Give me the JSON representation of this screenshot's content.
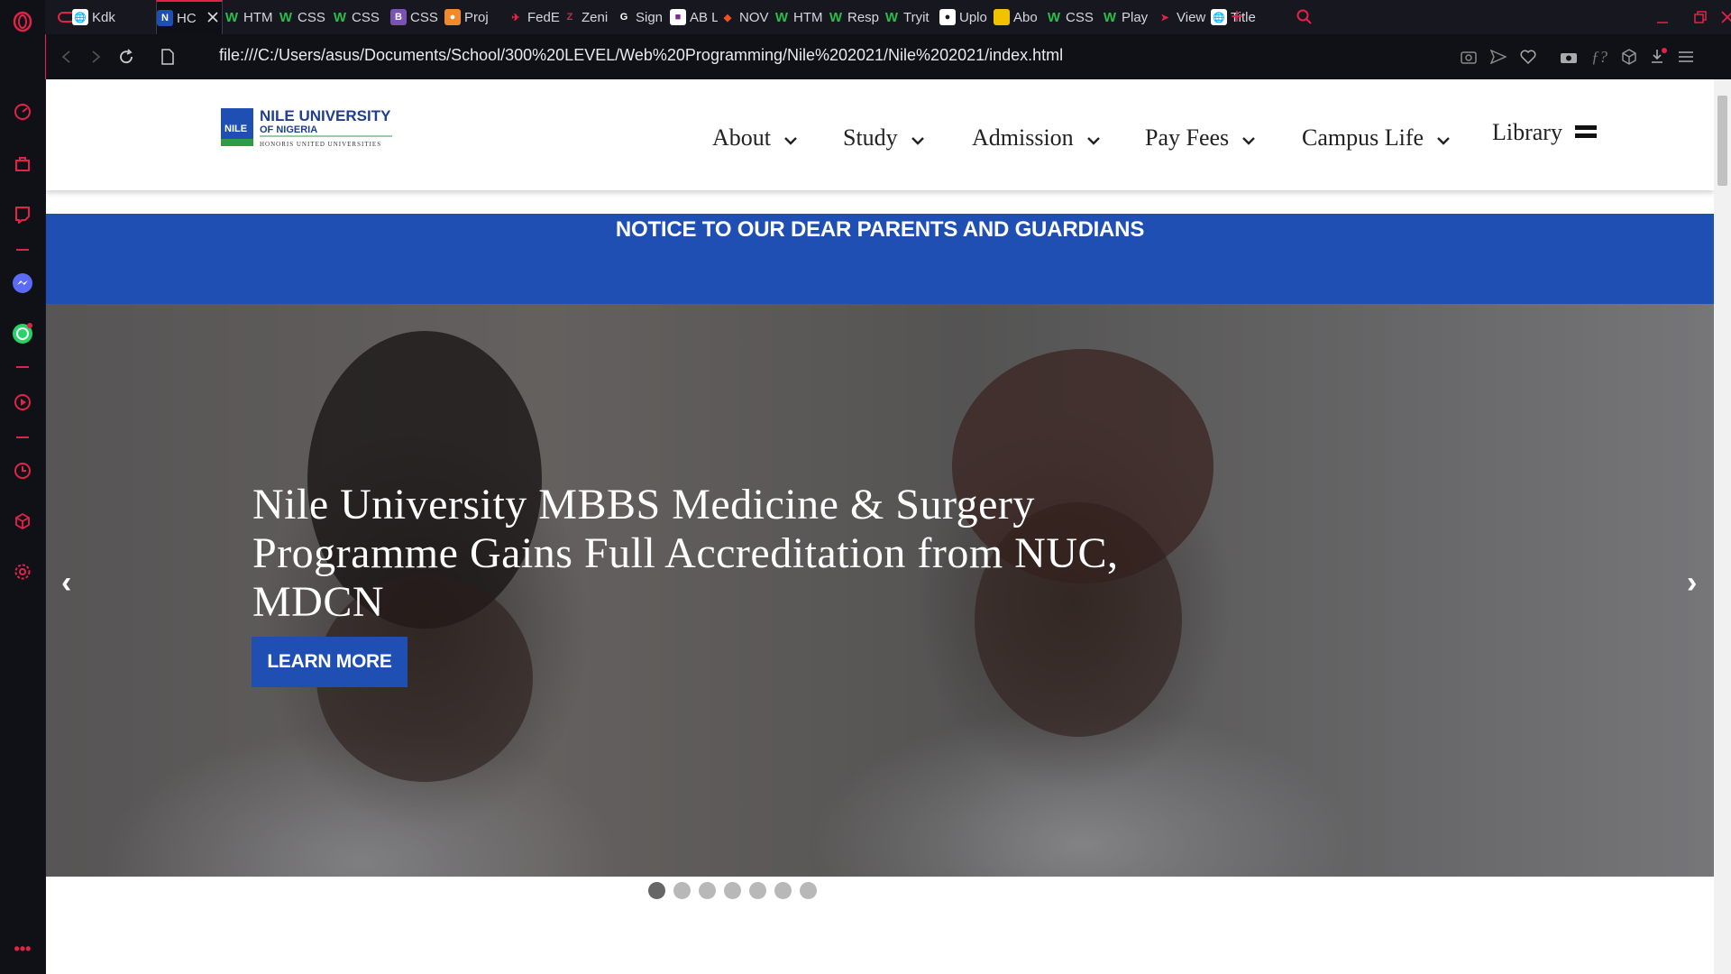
{
  "browser": {
    "tabs": [
      {
        "label": "Kdk",
        "icon": "globe-icon"
      },
      {
        "label": "HC",
        "icon": "nile-favicon-icon",
        "active": true
      },
      {
        "label": "HTM",
        "icon": "w3schools-icon"
      },
      {
        "label": "CSS",
        "icon": "w3schools-icon"
      },
      {
        "label": "CSS",
        "icon": "w3schools-icon"
      },
      {
        "label": "CSS",
        "icon": "bootstrap-icon"
      },
      {
        "label": "Proj",
        "icon": "person-icon"
      },
      {
        "label": "FedE",
        "icon": "fedex-icon"
      },
      {
        "label": "Zeni",
        "icon": "zenith-icon"
      },
      {
        "label": "Sign",
        "icon": "gig-icon"
      },
      {
        "label": "AB L",
        "icon": "app-icon"
      },
      {
        "label": "NOV",
        "icon": "figma-icon"
      },
      {
        "label": "HTM",
        "icon": "w3schools-icon"
      },
      {
        "label": "Resp",
        "icon": "w3schools-icon"
      },
      {
        "label": "Tryit",
        "icon": "w3schools-icon"
      },
      {
        "label": "Uplo",
        "icon": "github-icon"
      },
      {
        "label": "Abo",
        "icon": "yellow-icon"
      },
      {
        "label": "CSS",
        "icon": "w3schools-icon"
      },
      {
        "label": "Play",
        "icon": "w3schools-icon"
      },
      {
        "label": "View",
        "icon": "view-icon"
      },
      {
        "label": "Title",
        "icon": "globe-icon"
      }
    ],
    "url": "file:///C:/Users/asus/Documents/School/300%20LEVEL/Web%20Programming/Nile%202021/Nile%202021/index.html",
    "accent_color": "#e3224a"
  },
  "site": {
    "logo": {
      "name": "NILE UNIVERSITY",
      "sub": "OF NIGERIA",
      "tagline": "HONORIS UNITED UNIVERSITIES",
      "badge": "NILE"
    },
    "nav": [
      {
        "label": "About",
        "has_dropdown": true
      },
      {
        "label": "Study",
        "has_dropdown": true
      },
      {
        "label": "Admission",
        "has_dropdown": true
      },
      {
        "label": "Pay Fees",
        "has_dropdown": true
      },
      {
        "label": "Campus Life",
        "has_dropdown": true
      },
      {
        "label": "Library",
        "has_dropdown": false
      }
    ],
    "notice": "NOTICE TO OUR DEAR PARENTS AND GUARDIANS",
    "hero": {
      "title": "Nile University MBBS Medicine & Surgery Programme Gains Full Accreditation from NUC, MDCN",
      "button": "LEARN MORE",
      "prev": "‹",
      "next": "›",
      "slide_count": 7,
      "active_slide": 1
    },
    "brand_blue": "#1f4fb3"
  }
}
